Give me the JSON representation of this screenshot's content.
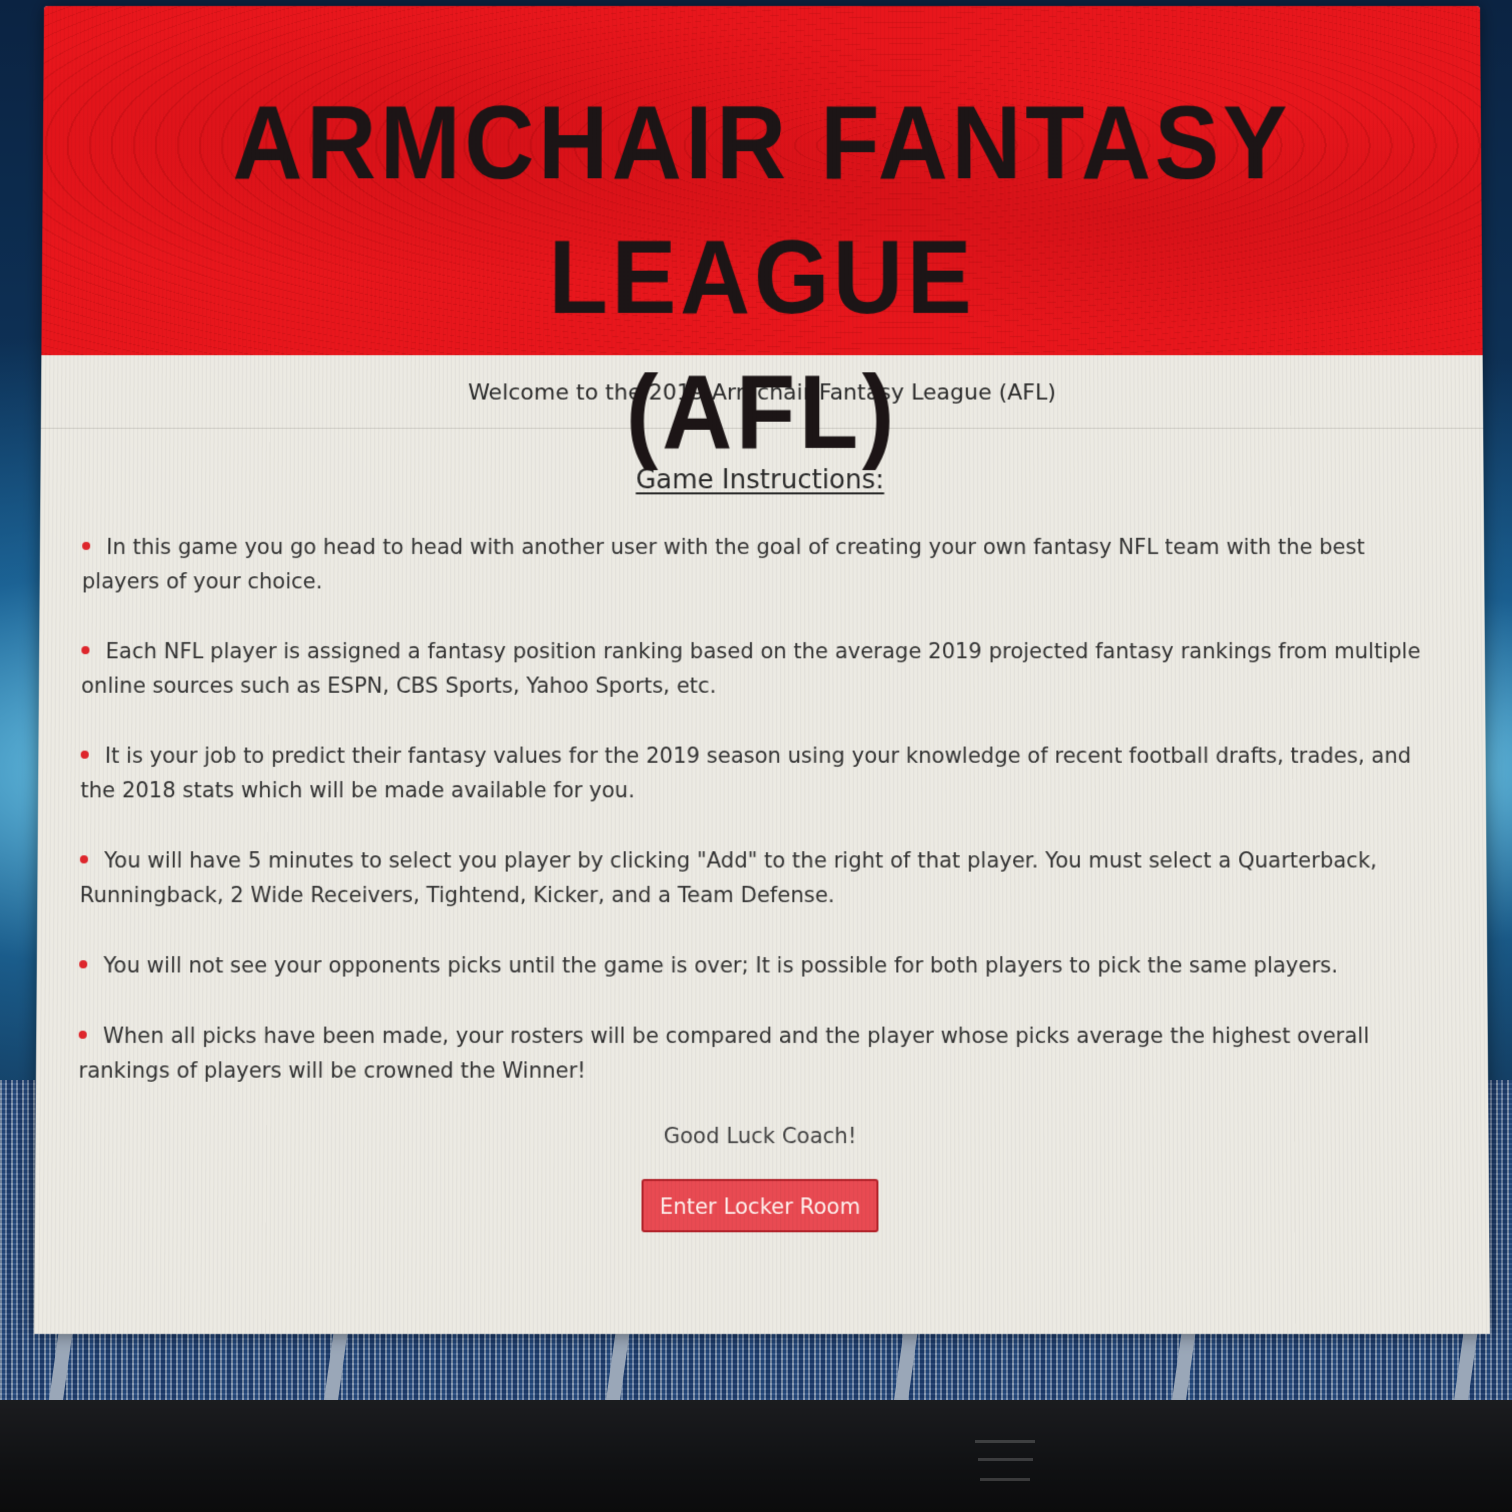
{
  "banner": {
    "title_line1": "ARMCHAIR FANTASY LEAGUE",
    "title_line2": "(AFL)"
  },
  "welcome_text": "Welcome to the 2019 Armchair Fantasy League (AFL)",
  "instructions": {
    "heading": "Game Instructions:",
    "rules": [
      "In this game you go head to head with another user with the goal of creating your own fantasy NFL team with the best players of your choice.",
      "Each NFL player is assigned a fantasy position ranking based on the average 2019 projected fantasy rankings from multiple online sources such as ESPN, CBS Sports, Yahoo Sports, etc.",
      "It is your job to predict their fantasy values for the 2019 season using your knowledge of recent football drafts, trades, and the 2018 stats which will be made available for you.",
      "You will have 5 minutes to select you player by clicking \"Add\" to the right of that player. You must select a Quarterback, Runningback, 2 Wide Receivers, Tightend, Kicker, and a Team Defense.",
      "You will not see your opponents picks until the game is over; It is possible for both players to pick the same players.",
      "When all picks have been made, your rosters will be compared and the player whose picks average the highest overall rankings of players will be crowned the Winner!"
    ]
  },
  "sign_off": "Good Luck Coach!",
  "enter_button_label": "Enter Locker Room",
  "colors": {
    "banner_red": "#e8161c",
    "bullet_red": "#e0262c",
    "button_red": "#e94a52"
  },
  "icons": {
    "bullet": "red-dot-bullet-icon"
  }
}
